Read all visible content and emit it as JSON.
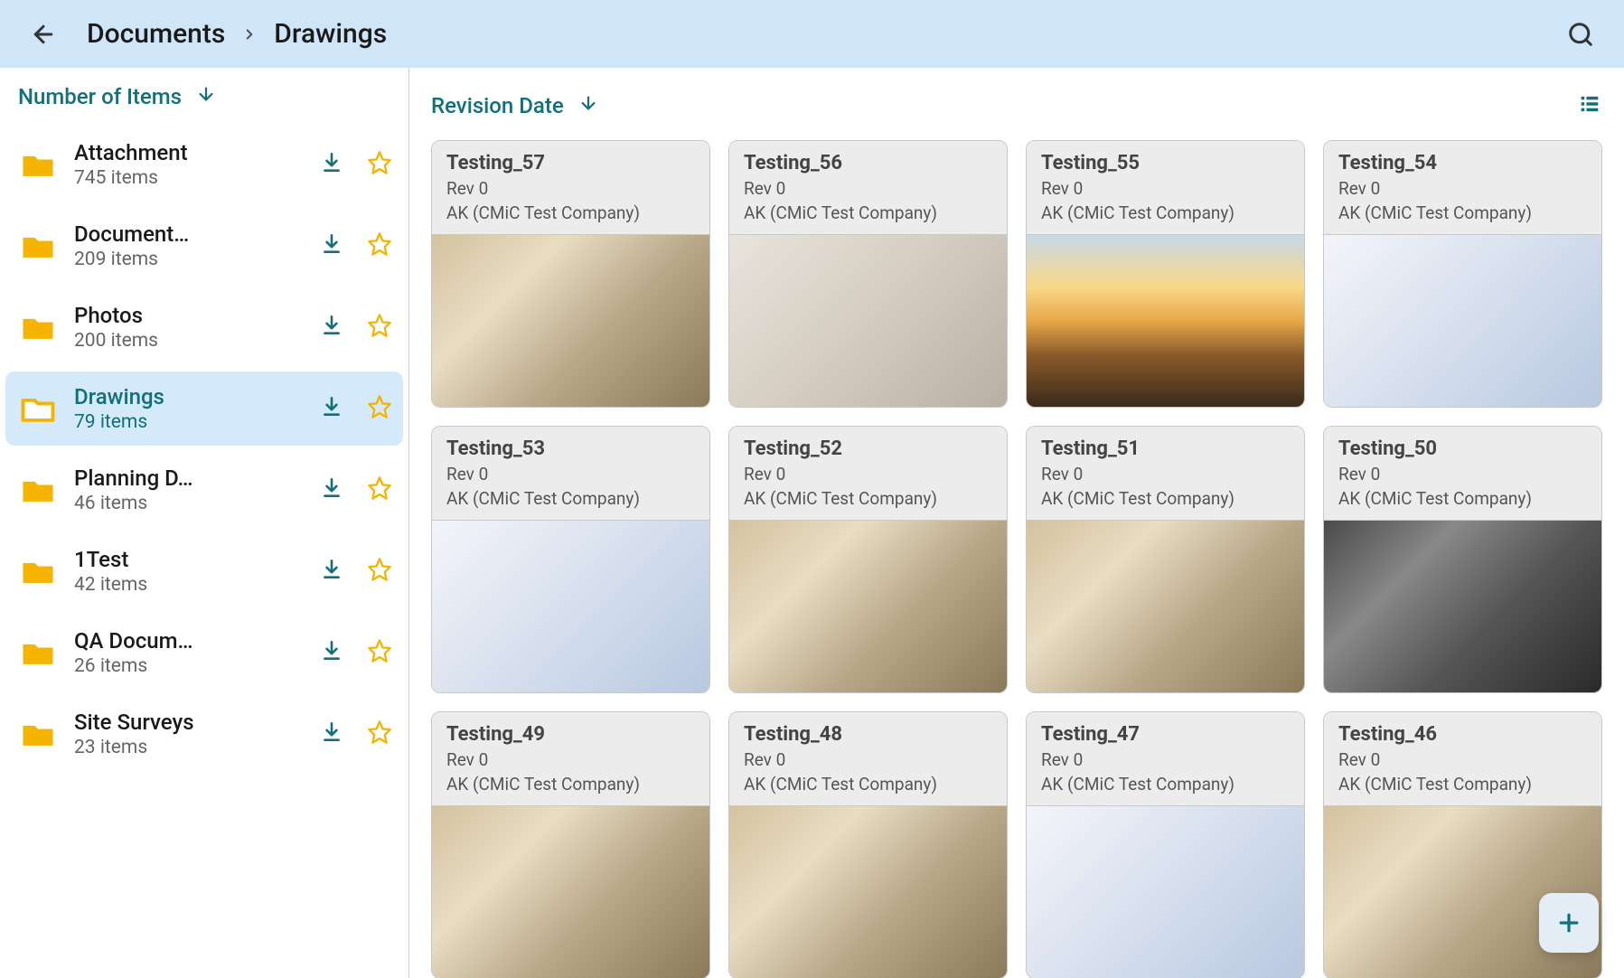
{
  "header": {
    "breadcrumbParent": "Documents",
    "breadcrumbCurrent": "Drawings"
  },
  "sidebar": {
    "sortLabel": "Number of Items",
    "folders": [
      {
        "name": "Attachment",
        "count": "745 items",
        "active": false
      },
      {
        "name": "Document…",
        "count": "209 items",
        "active": false
      },
      {
        "name": "Photos",
        "count": "200 items",
        "active": false
      },
      {
        "name": "Drawings",
        "count": "79 items",
        "active": true
      },
      {
        "name": "Planning D…",
        "count": "46 items",
        "active": false
      },
      {
        "name": "1Test",
        "count": "42 items",
        "active": false
      },
      {
        "name": "QA Docum…",
        "count": "26 items",
        "active": false
      },
      {
        "name": "Site Surveys",
        "count": "23 items",
        "active": false
      }
    ]
  },
  "main": {
    "sortLabel": "Revision Date",
    "cards": [
      {
        "title": "Testing_57",
        "rev": "Rev 0",
        "author": "AK (CMiC Test Company)",
        "imgClass": ""
      },
      {
        "title": "Testing_56",
        "rev": "Rev 0",
        "author": "AK (CMiC Test Company)",
        "imgClass": "table"
      },
      {
        "title": "Testing_55",
        "rev": "Rev 0",
        "author": "AK (CMiC Test Company)",
        "imgClass": "sunset"
      },
      {
        "title": "Testing_54",
        "rev": "Rev 0",
        "author": "AK (CMiC Test Company)",
        "imgClass": "blueprint"
      },
      {
        "title": "Testing_53",
        "rev": "Rev 0",
        "author": "AK (CMiC Test Company)",
        "imgClass": "blueprint"
      },
      {
        "title": "Testing_52",
        "rev": "Rev 0",
        "author": "AK (CMiC Test Company)",
        "imgClass": ""
      },
      {
        "title": "Testing_51",
        "rev": "Rev 0",
        "author": "AK (CMiC Test Company)",
        "imgClass": ""
      },
      {
        "title": "Testing_50",
        "rev": "Rev 0",
        "author": "AK (CMiC Test Company)",
        "imgClass": "bw"
      },
      {
        "title": "Testing_49",
        "rev": "Rev 0",
        "author": "AK (CMiC Test Company)",
        "imgClass": ""
      },
      {
        "title": "Testing_48",
        "rev": "Rev 0",
        "author": "AK (CMiC Test Company)",
        "imgClass": ""
      },
      {
        "title": "Testing_47",
        "rev": "Rev 0",
        "author": "AK (CMiC Test Company)",
        "imgClass": "blueprint"
      },
      {
        "title": "Testing_46",
        "rev": "Rev 0",
        "author": "AK (CMiC Test Company)",
        "imgClass": ""
      }
    ]
  }
}
